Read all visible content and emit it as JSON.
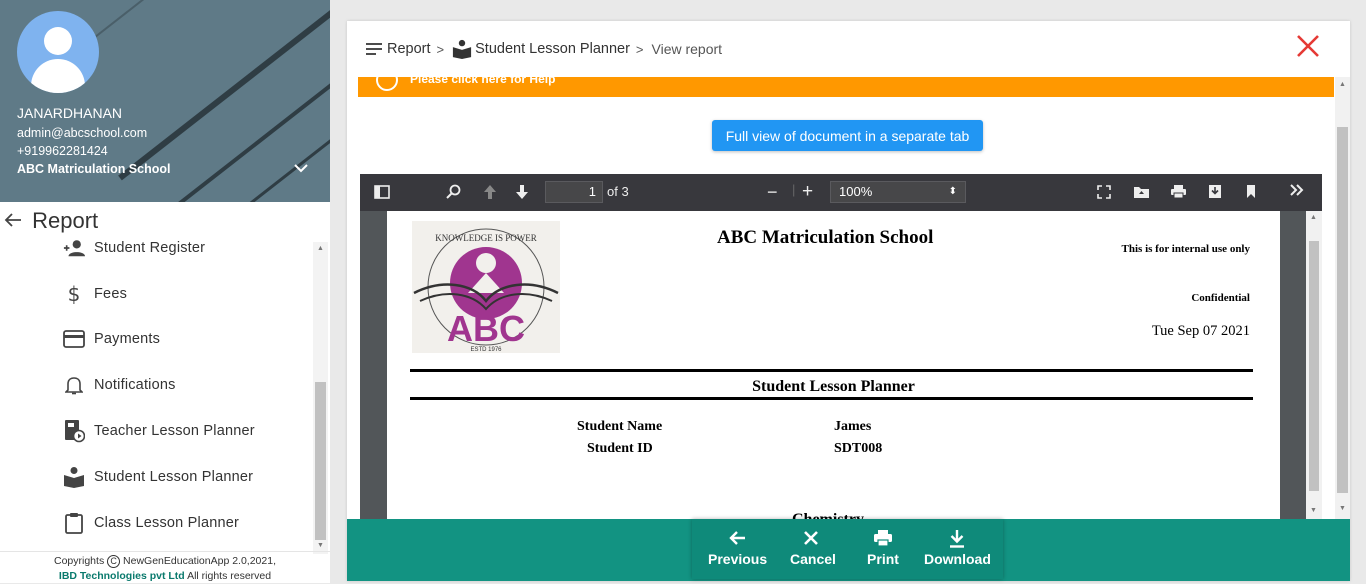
{
  "profile": {
    "name": "JANARDHANAN",
    "email": "admin@abcschool.com",
    "phone": "+919962281424",
    "school": "ABC Matriculation School"
  },
  "sidebar": {
    "section_title": "Report",
    "items": [
      {
        "label": "Student Register",
        "icon": "person-add-icon"
      },
      {
        "label": "Fees",
        "icon": "dollar-icon"
      },
      {
        "label": "Payments",
        "icon": "credit-card-icon"
      },
      {
        "label": "Notifications",
        "icon": "bell-icon"
      },
      {
        "label": "Teacher Lesson Planner",
        "icon": "teacher-planner-icon"
      },
      {
        "label": "Student Lesson Planner",
        "icon": "student-reading-icon"
      },
      {
        "label": "Class Lesson Planner",
        "icon": "clipboard-icon"
      }
    ],
    "footer": {
      "copyright_prefix": "Copyrights",
      "copyright_app": "NewGenEducationApp 2.0,2021,",
      "company": "IBD Technologies pvt Ltd",
      "rights": "All rights reserved"
    }
  },
  "breadcrumb": {
    "root": "Report",
    "sep1": ">",
    "section": "Student Lesson Planner",
    "sep2": ">",
    "current": "View report"
  },
  "help_bar": {
    "text": "Please click here for Help"
  },
  "full_view_button": "Full view of document in a separate tab",
  "pdf_viewer": {
    "page_number": "1",
    "page_of": "of 3",
    "zoom": "100%"
  },
  "document": {
    "school": "ABC Matriculation School",
    "internal_note": "This is for internal use only",
    "confidential": "Confidential",
    "date": "Tue Sep 07 2021",
    "title": "Student Lesson Planner",
    "fields": [
      {
        "label": "Student Name",
        "value": "James"
      },
      {
        "label": "Student ID",
        "value": "SDT008"
      }
    ],
    "next_heading": "Chemistry",
    "logo": {
      "motto": "KNOWLEDGE IS POWER",
      "letters": "ABC",
      "estd": "ESTD 1976"
    }
  },
  "actions": {
    "previous": "Previous",
    "cancel": "Cancel",
    "print": "Print",
    "download": "Download"
  },
  "colors": {
    "accent_teal": "#129382",
    "help_orange": "#ff9800",
    "button_blue": "#2196f3",
    "close_red": "#e53935",
    "profile_bg": "#5f7a87",
    "logo_purple": "#a0358f"
  }
}
